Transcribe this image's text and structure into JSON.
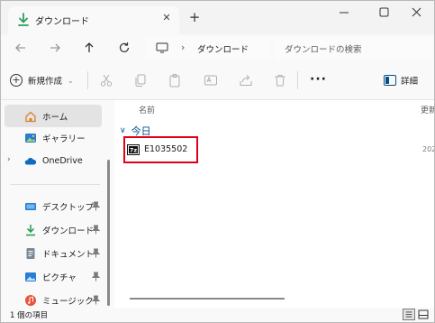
{
  "titlebar": {
    "tab_title": "ダウンロード",
    "tab_close": "✕",
    "new_tab": "+"
  },
  "navigation": {
    "address_chevron": "›",
    "address_location": "ダウンロード",
    "search_placeholder": "ダウンロードの検索"
  },
  "toolbar": {
    "new_label": "新規作成",
    "new_caret": "⌄",
    "more": "···",
    "details_label": "詳細"
  },
  "sidebar": {
    "items": [
      {
        "label": "ホーム",
        "icon": "home-icon",
        "selected": true
      },
      {
        "label": "ギャラリー",
        "icon": "gallery-icon"
      },
      {
        "label": "OneDrive",
        "icon": "onedrive-icon",
        "expandable": true
      },
      {
        "label": "デスクトップ",
        "icon": "desktop-icon",
        "pinned": true
      },
      {
        "label": "ダウンロード",
        "icon": "download-icon",
        "pinned": true
      },
      {
        "label": "ドキュメント",
        "icon": "documents-icon",
        "pinned": true
      },
      {
        "label": "ピクチャ",
        "icon": "pictures-icon",
        "pinned": true
      },
      {
        "label": "ミュージック",
        "icon": "music-icon",
        "pinned": true
      }
    ],
    "expand_chevron": "›"
  },
  "content": {
    "column_name": "名前",
    "column_date": "更新",
    "group_chevron": "∨",
    "group_label": "今日",
    "files": [
      {
        "name": "E1035502",
        "icon": "7zip-archive-icon",
        "date": "202"
      }
    ]
  },
  "statusbar": {
    "item_count": "1 個の項目"
  },
  "colors": {
    "accent": "#004e8c",
    "highlight": "#e0001a",
    "download_green": "#2aa05a"
  }
}
